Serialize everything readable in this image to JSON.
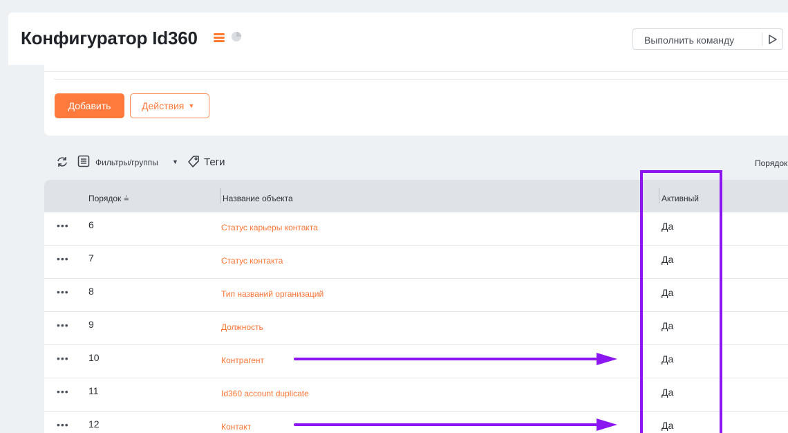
{
  "header": {
    "title": "Конфигуратор Id360",
    "command_label": "Выполнить команду",
    "menu_icon": "menu-icon",
    "chart_icon": "pie-chart-icon",
    "play_icon": "play-icon"
  },
  "toolbar": {
    "add_label": "Добавить",
    "actions_label": "Действия"
  },
  "filter_bar": {
    "filters_label": "Фильтры/группы",
    "tags_label": "Теги",
    "order_label": "Порядок"
  },
  "table": {
    "columns": {
      "order": "Порядок",
      "name": "Название объекта",
      "active": "Активный"
    },
    "rows": [
      {
        "order": "6",
        "name": "Статус карьеры контакта",
        "active": "Да"
      },
      {
        "order": "7",
        "name": "Статус контакта",
        "active": "Да"
      },
      {
        "order": "8",
        "name": "Тип названий организаций",
        "active": "Да"
      },
      {
        "order": "9",
        "name": "Должность",
        "active": "Да"
      },
      {
        "order": "10",
        "name": "Контрагент",
        "active": "Да"
      },
      {
        "order": "11",
        "name": "Id360 account duplicate",
        "active": "Да"
      },
      {
        "order": "12",
        "name": "Контакт",
        "active": "Да"
      }
    ]
  },
  "colors": {
    "accent": "#ff7a3c",
    "annotation": "#8b16f2"
  }
}
